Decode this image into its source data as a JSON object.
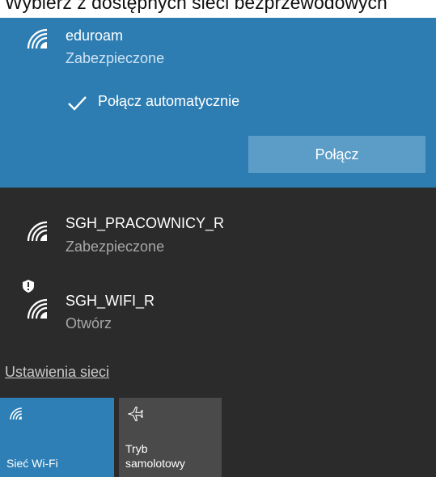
{
  "page_header": {
    "text": "Wybierz z dostępnych sieci bezprzewodowych"
  },
  "networks": [
    {
      "name": "eduroam",
      "status": "Zabezpieczone",
      "selected": true,
      "icon": "wifi-signal-icon",
      "auto_connect_label": "Połącz automatycznie",
      "auto_connect_checked": true,
      "connect_label": "Połącz"
    },
    {
      "name": "SGH_PRACOWNICY_R",
      "status": "Zabezpieczone",
      "icon": "wifi-signal-icon"
    },
    {
      "name": "SGH_WIFI_R",
      "status": "Otwórz",
      "icon": "wifi-signal-open-warning-icon"
    }
  ],
  "settings_link": "Ustawienia sieci",
  "quick_actions": [
    {
      "label": "Sieć Wi-Fi",
      "active": true,
      "icon": "wifi-icon"
    },
    {
      "label": "Tryb\nsamolotowy",
      "active": false,
      "icon": "airplane-icon"
    }
  ],
  "colors": {
    "selected_background": "#2d7db3",
    "panel_background": "#2b2b2b",
    "connect_button": "#5c9dc8",
    "active_tile": "#2e7fb5",
    "inactive_tile": "#4a4a4a"
  }
}
